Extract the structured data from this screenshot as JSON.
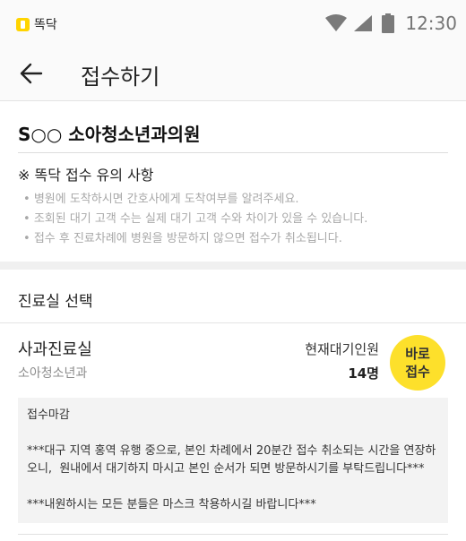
{
  "status_bar": {
    "app_name": "똑닥",
    "time": "12:30",
    "icons": [
      "wifi-icon",
      "signal-icon",
      "battery-icon"
    ]
  },
  "app_bar": {
    "title": "접수하기",
    "back_icon": "arrow-left-icon"
  },
  "clinic": {
    "name": "S○○ 소아청소년과의원"
  },
  "notice": {
    "title": "※ 똑닥 접수 유의 사항",
    "items": [
      "병원에 도착하시면 간호사에게 도착여부를 알려주세요.",
      "조회된 대기 고객 수는 실제 대기 고객 수와 차이가 있을 수 있습니다.",
      "접수 후 진료차례에 병원을 방문하지 않으면 접수가 취소됩니다."
    ]
  },
  "room_section": {
    "title": "진료실 선택"
  },
  "room": {
    "name": "사과진료실",
    "department": "소아청소년과",
    "waiting_label": "현재대기인원",
    "waiting_count": "14명",
    "reserve_button": "바로 접수"
  },
  "room_notice": {
    "title": "접수마감",
    "body": "***대구 지역 홍역 유행 중으로, 본인 차례에서 20분간 접수 취소되는 시간을 연장하오니,  원내에서 대기하지 마시고 본인 순서가 되면 방문하시기를 부탁드립니다***",
    "body2": "***내원하시는 모든 분들은 마스크 착용하시길 바랍니다***"
  },
  "colors": {
    "accent": "#fde02b",
    "logo": "#ffd400",
    "muted_text": "#a8a8a8"
  }
}
